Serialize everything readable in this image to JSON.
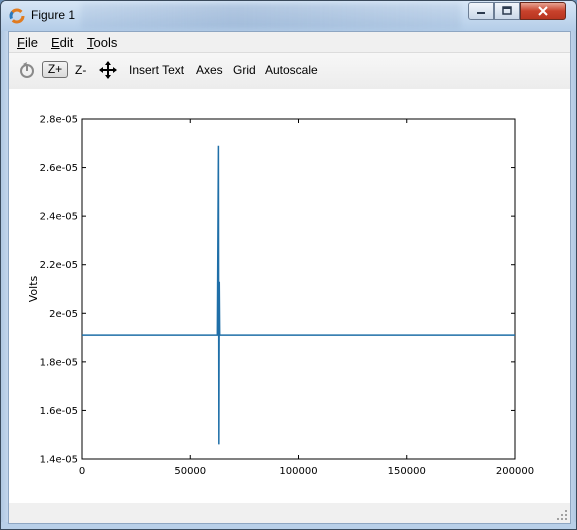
{
  "window": {
    "title": "Figure 1",
    "controls": {
      "minimize": "–",
      "maximize": "□",
      "close": "✕"
    }
  },
  "menubar": {
    "items": [
      {
        "label_u": "F",
        "label_rest": "ile"
      },
      {
        "label_u": "E",
        "label_rest": "dit"
      },
      {
        "label_u": "T",
        "label_rest": "ools"
      }
    ]
  },
  "toolbar": {
    "zoom_in": "Z+",
    "zoom_out": "Z-",
    "insert_text": "Insert Text",
    "axes": "Axes",
    "grid": "Grid",
    "autoscale": "Autoscale"
  },
  "colors": {
    "series": "#1f6fa8",
    "axis": "#000000"
  },
  "chart_data": {
    "type": "line",
    "title": "",
    "xlabel": "",
    "ylabel": "Volts",
    "xlim": [
      0,
      200000
    ],
    "ylim": [
      1.4e-05,
      2.8e-05
    ],
    "x_ticks": [
      0,
      50000,
      100000,
      150000,
      200000
    ],
    "x_tick_labels": [
      "0",
      "50000",
      "100000",
      "150000",
      "200000"
    ],
    "y_ticks": [
      1.4e-05,
      1.6e-05,
      1.8e-05,
      2e-05,
      2.2e-05,
      2.4e-05,
      2.6e-05,
      2.8e-05
    ],
    "y_tick_labels": [
      "1.4e-05",
      "1.6e-05",
      "1.8e-05",
      "2e-05",
      "2.2e-05",
      "2.4e-05",
      "2.6e-05",
      "2.8e-05"
    ],
    "grid": false,
    "series": [
      {
        "baseline": 1.91e-05,
        "x": [
          0,
          50000,
          62500,
          63000,
          63200,
          63400,
          63600,
          100000,
          150000,
          200000
        ],
        "y": [
          1.91e-05,
          1.91e-05,
          1.91e-05,
          2.69e-05,
          1.46e-05,
          2.13e-05,
          1.91e-05,
          1.91e-05,
          1.91e-05,
          1.91e-05
        ]
      }
    ]
  }
}
